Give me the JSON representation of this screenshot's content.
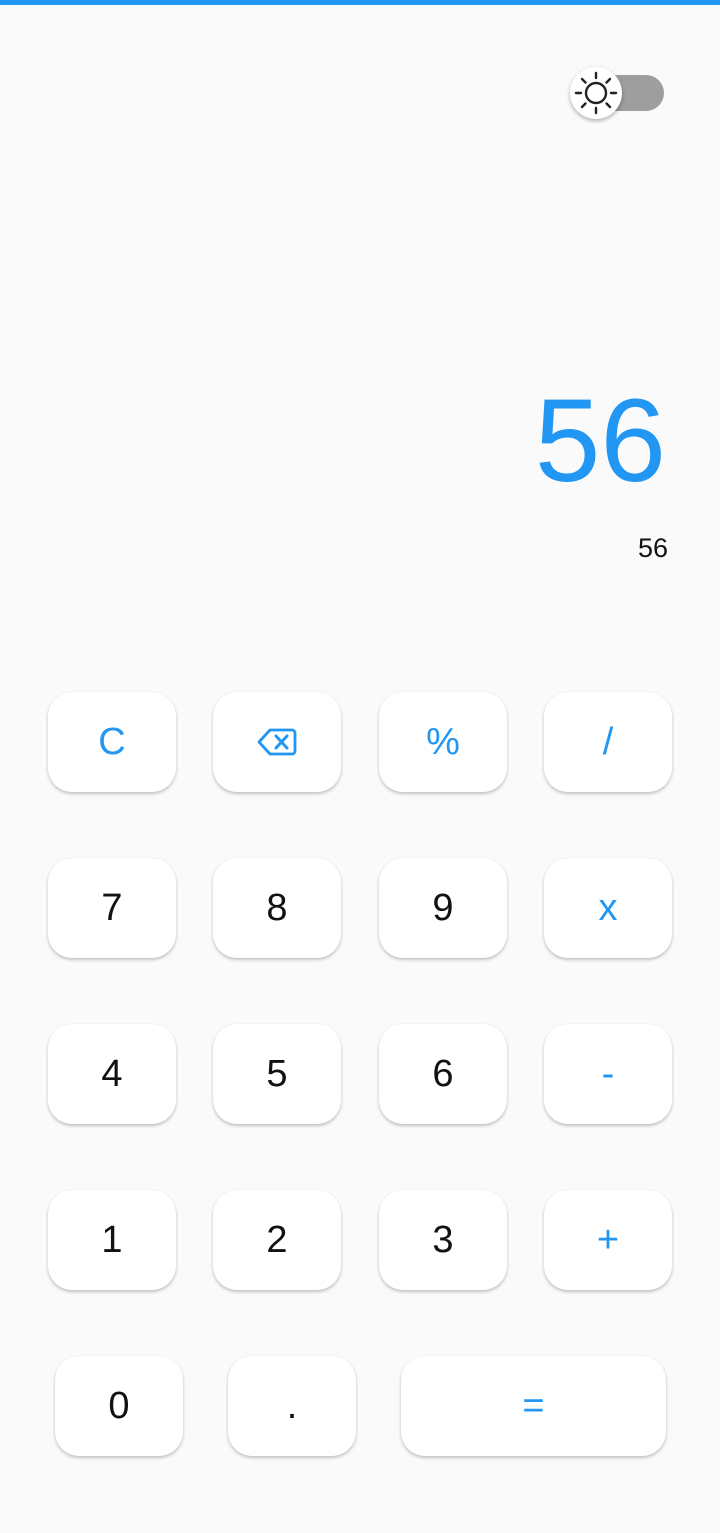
{
  "theme_toggle": {
    "icon": "sun-icon",
    "state": "off",
    "track_color": "#9e9e9e",
    "thumb_color": "#ffffff"
  },
  "display": {
    "result": "56",
    "expression": "56"
  },
  "colors": {
    "accent": "#2196f3",
    "background": "#fafafa",
    "key_background": "#ffffff",
    "digit_text": "#111111"
  },
  "keypad": {
    "clear": "C",
    "backspace_icon": "backspace-icon",
    "percent": "%",
    "divide": "/",
    "seven": "7",
    "eight": "8",
    "nine": "9",
    "multiply": "x",
    "four": "4",
    "five": "5",
    "six": "6",
    "subtract": "-",
    "one": "1",
    "two": "2",
    "three": "3",
    "add": "+",
    "zero": "0",
    "decimal": ".",
    "equals": "="
  }
}
